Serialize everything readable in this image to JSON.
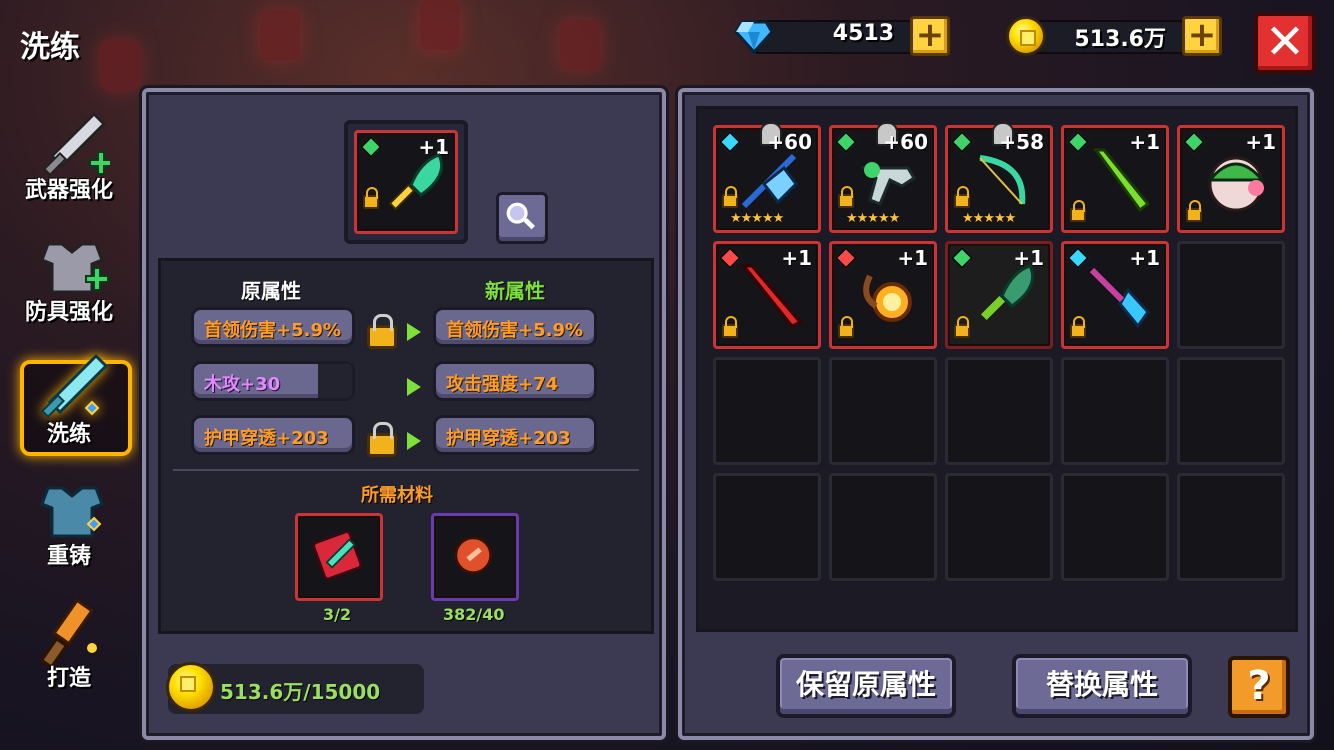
{
  "screen_title": "洗练",
  "currency": {
    "gems": "4513",
    "coins": "513.6万"
  },
  "sidebar": {
    "items": [
      {
        "label": "武器强化",
        "icon": "sword-upgrade-icon"
      },
      {
        "label": "防具强化",
        "icon": "armor-upgrade-icon"
      },
      {
        "label": "洗练",
        "icon": "refine-sword-icon",
        "active": true
      },
      {
        "label": "重铸",
        "icon": "recast-armor-icon"
      },
      {
        "label": "打造",
        "icon": "forge-hammer-icon"
      }
    ]
  },
  "selected_item": {
    "level": "+1",
    "element": "green",
    "icon": "jade-blade-icon"
  },
  "attributes": {
    "original_header": "原属性",
    "new_header": "新属性",
    "rows": [
      {
        "original": "首领伤害+5.9%",
        "locked": true,
        "new": "首领伤害+5.9%"
      },
      {
        "original": "木攻+30",
        "locked": false,
        "new": "攻击强度+74"
      },
      {
        "original": "护甲穿透+203",
        "locked": true,
        "new": "护甲穿透+203"
      }
    ]
  },
  "materials": {
    "header": "所需材料",
    "items": [
      {
        "count": "3/2",
        "icon": "weapon-scroll-icon"
      },
      {
        "count": "382/40",
        "icon": "red-gem-icon"
      }
    ]
  },
  "cost": {
    "coins": "513.6万/15000"
  },
  "inventory": {
    "rows": 4,
    "cols": 5,
    "items": [
      {
        "level": "+60",
        "element": "cyan",
        "stars": 5,
        "icon": "ice-crossbow-icon",
        "bell": true
      },
      {
        "level": "+60",
        "element": "green",
        "stars": 5,
        "icon": "skull-gun-icon",
        "bell": true
      },
      {
        "level": "+58",
        "element": "green",
        "stars": 5,
        "icon": "jade-bow-icon",
        "bell": true
      },
      {
        "level": "+1",
        "element": "green",
        "stars": 0,
        "icon": "green-sword-icon",
        "bell": false
      },
      {
        "level": "+1",
        "element": "green",
        "stars": 0,
        "icon": "pig-helmet-icon",
        "bell": false
      },
      {
        "level": "+1",
        "element": "red",
        "stars": 0,
        "icon": "red-sword-icon",
        "bell": false
      },
      {
        "level": "+1",
        "element": "red",
        "stars": 0,
        "icon": "fire-orb-icon",
        "bell": false
      },
      {
        "level": "+1",
        "element": "green",
        "stars": 0,
        "icon": "jade-blade-icon",
        "bell": false,
        "dim": true
      },
      {
        "level": "+1",
        "element": "cyan",
        "stars": 0,
        "icon": "crystal-staff-icon",
        "bell": false
      }
    ]
  },
  "buttons": {
    "keep": "保留原属性",
    "replace": "替换属性",
    "help": "?"
  },
  "colors": {
    "panel": "#3c3a52",
    "orange_text": "#ff9c2a",
    "purple_text": "#e08aff",
    "green_text": "#7fe03a",
    "slot_border": "#c93535"
  }
}
